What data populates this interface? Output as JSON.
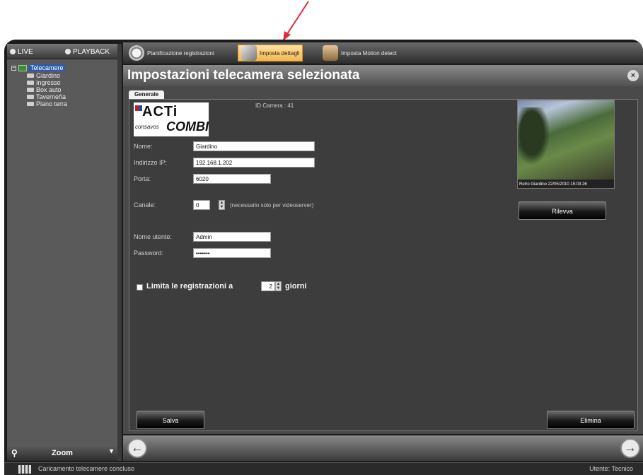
{
  "mode_tabs": {
    "live": "LIVE",
    "playback": "PLAYBACK"
  },
  "tree": {
    "root": "Telecamere",
    "children": [
      "Giardino",
      "Ingresso",
      "Box auto",
      "Taverneña",
      "Piano terra"
    ]
  },
  "zoom_label": "Zoom",
  "toolbar": {
    "items": [
      {
        "label": "Pianificazione registrazioni",
        "icon": "clock-icon"
      },
      {
        "label": "Imposta dettagli",
        "icon": "camera-icon",
        "active": true
      },
      {
        "label": "Imposta Motion detect",
        "icon": "person-icon"
      }
    ]
  },
  "panel": {
    "title": "Impostazioni telecamera selezionata",
    "tab": "Generale",
    "logo": {
      "brand": "ACTi",
      "sub": "consavos",
      "product": "COMBI"
    },
    "id_camera": "ID Camera : 41",
    "fields": {
      "nome": {
        "label": "Nome:",
        "value": "Giardino"
      },
      "ip": {
        "label": "Indirizzo IP:",
        "value": "192.168.1.202"
      },
      "porta": {
        "label": "Porta:",
        "value": "6020"
      },
      "canale": {
        "label": "Canale:",
        "value": "0",
        "hint": "(necessario solo per videoserver)"
      },
      "utente": {
        "label": "Nome utente:",
        "value": "Admin"
      },
      "password": {
        "label": "Password:",
        "value": "•••••••"
      }
    },
    "limit": {
      "prefix": "Limita le registrazioni a",
      "value": "2",
      "suffix": "giorni",
      "checked": false
    },
    "preview_caption": "Retro Giardino 22/05/2010 15:03:26",
    "buttons": {
      "refresh": "Rilevva",
      "save": "Salva",
      "delete": "Elimina"
    }
  },
  "status": {
    "left": "Caricamento telecamere concluso",
    "right": "Utente: Tecnico"
  },
  "colors": {
    "accent": "#f5b64e",
    "annotation_arrow": "#e0283a"
  }
}
